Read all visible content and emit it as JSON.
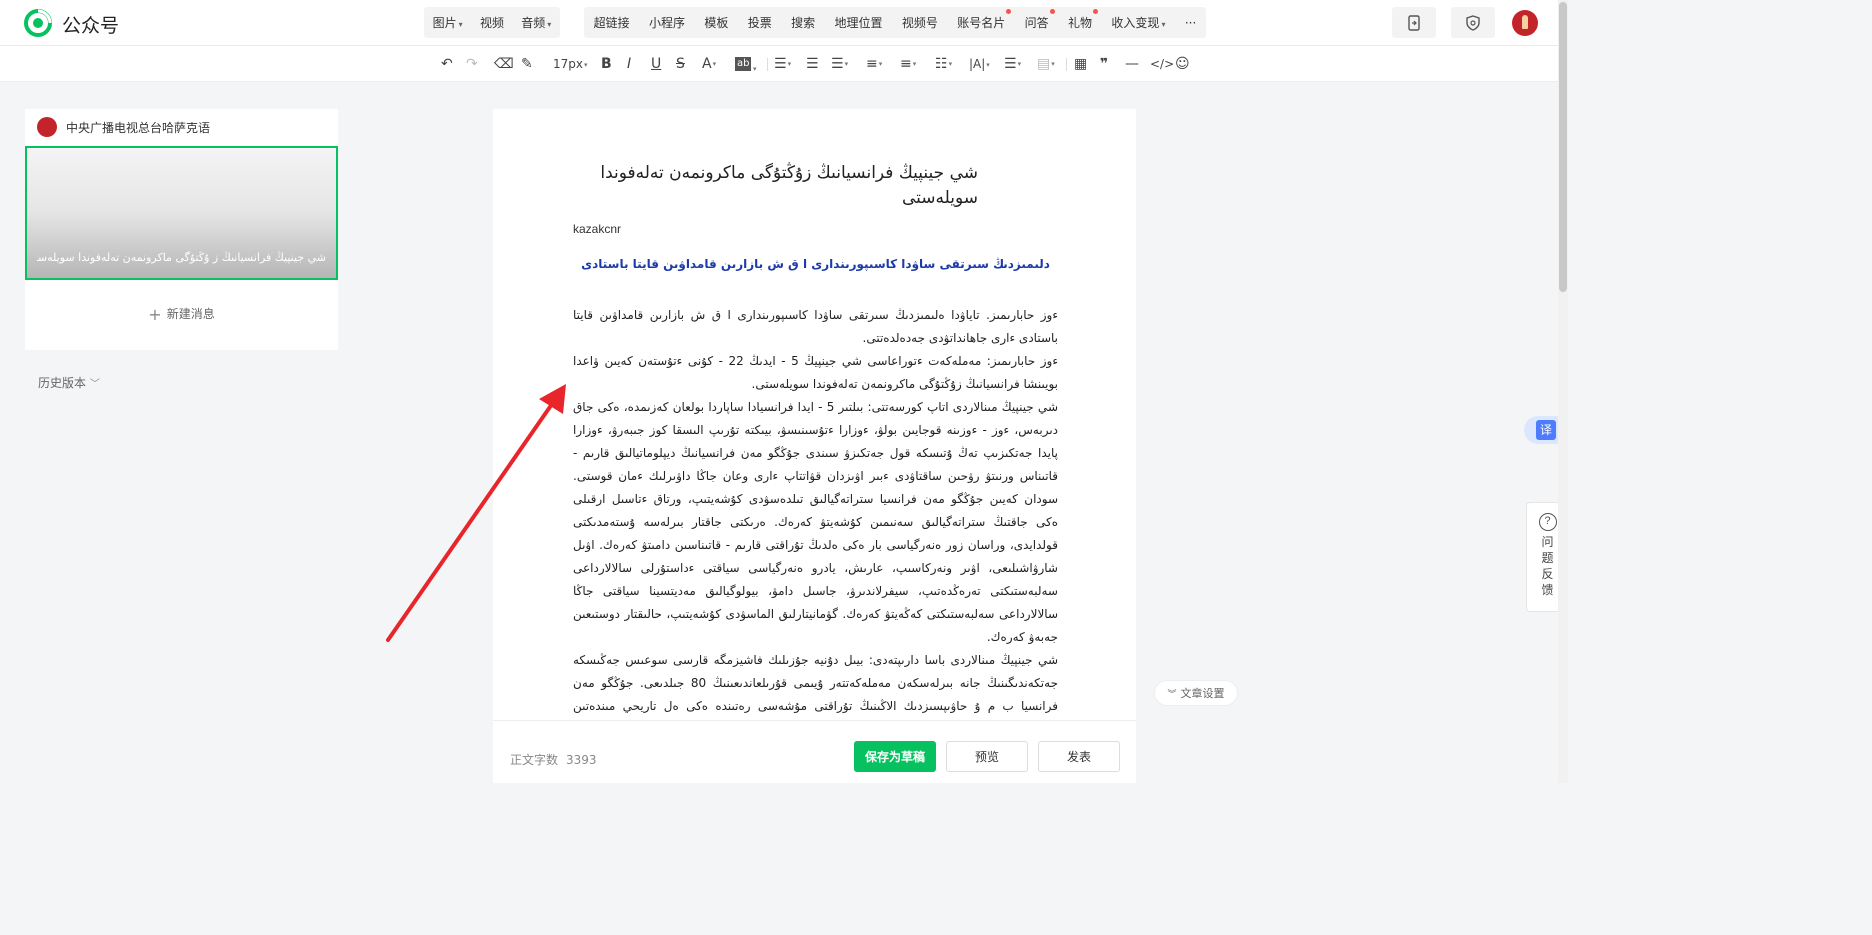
{
  "app": {
    "brand": "公众号"
  },
  "topnav": {
    "group1": [
      {
        "label": "图片",
        "dropdown": true
      },
      {
        "label": "视频",
        "dropdown": false
      },
      {
        "label": "音频",
        "dropdown": true
      }
    ],
    "group2": [
      {
        "label": "超链接",
        "dropdown": false,
        "dot": false
      },
      {
        "label": "小程序",
        "dropdown": false,
        "dot": false
      },
      {
        "label": "模板",
        "dropdown": false,
        "dot": false
      },
      {
        "label": "投票",
        "dropdown": false,
        "dot": false
      },
      {
        "label": "搜索",
        "dropdown": false,
        "dot": false
      },
      {
        "label": "地理位置",
        "dropdown": false,
        "dot": false
      },
      {
        "label": "视频号",
        "dropdown": false,
        "dot": false
      },
      {
        "label": "账号名片",
        "dropdown": false,
        "dot": true
      },
      {
        "label": "问答",
        "dropdown": false,
        "dot": true
      },
      {
        "label": "礼物",
        "dropdown": false,
        "dot": true
      },
      {
        "label": "收入变现",
        "dropdown": true,
        "dot": false
      },
      {
        "label": "···",
        "dropdown": false,
        "dot": false
      }
    ]
  },
  "toolbar": {
    "font_size": "17px"
  },
  "sidebar": {
    "account_name": "中央广播电视总台哈萨克语",
    "cover_title": "شي جينپيڭ فرانسيانىڭ ز ۇڭتۇگى ماكرونمەن تەلەفوندا سويلەستى",
    "new_message": "新建消息",
    "history": "历史版本"
  },
  "article": {
    "title": "شي جينپيڭ فرانسيانىڭ زۇڭتۇگى ماكرونمەن تەلەفوندا سويلەستى",
    "author": "kazakcnr",
    "subhead": "دلىمىزدىڭ سىرتقى ساۋدا كاسىپورىندارى ا ق ش بازارىن قامداۋىن قايتا باستادى",
    "paragraphs": [
      "ءوز حابارىمىز. تاياۋدا ەلىمىزدىڭ سىرتقى ساۋدا كاسىپورىندارى ا ق ش بازارىن قامداۋىن قايتا باستادى ءارى جاھانداتۋدى جەدەلدەتتى.",
      "ءوز حابارىمىز: مەملەكەت ءتوراعاسى شي جينپيڭ 5 - ايدىڭ 22 - كۇنى ءتۇستەن كەيىن ۋاعدا بويىنشا فرانسيانىڭ زۇڭتۇگى ماكرونمەن تەلەفوندا سويلەستى.",
      "شي جينپيڭ مىنالاردى اتاپ كورسەتتى: بىلتىر 5 - ايدا فرانسيادا ساپاردا بولعان كەزىمدە، ەكى جاق دىربەس، ءوز - ءوزىنە قوجايىن بولۋ، ءوزارا ءتۇسىنىسۋ، بيىكتە تۇرىپ الىسقا كوز جىبەرۋ، ءوزارا پايدا جەتكىزىپ تەڭ ۇتىسكە قول جەتكىزۋ سىندى جۇڭگو مەن فرانسيانىڭ ديپلوماتيالىق قارىم - قاتىناس ورنىتۋ رۋحىن ساقتاۋدى ءبىر اۋىزدان قۋاتتاپ ءارى وعان جاڭا داۋىرلىك ءمان قوستى. سودان كەيىن جۇڭگو مەن فرانسيا ستراتەگيالىق تىلدەسۋدى كۇشەيتىپ، ورتاق ءتاسىل ارقىلى ەكى جاقتىڭ ستراتەگيالىق سەنىمىن كۇشەيتۋ كەرەك. ەرىكتى جاقتار بىرلەسە ۇستەمدىكتى قولدايدى، وراسان زور ەنەرگياسى بار ەكى ەلدىڭ تۇراقتى قارىم - قاتىناسىن دامىتۋ كەرەك. اۋىل شارۋاشىلىعى، اۋىر ونەركاسىپ، عارىش، يادرو ەنەرگياسى سياقتى ءداستۇرلى سالالارداعى سەلبەستىكتى تەرەڭدەتىپ، سيفرلاندىرۋ، جاسىل دامۋ، بيولوگيالىق مەديتسينا سياقتى جاڭا سالالارداعى سەلبەستىكتى كەڭەيتۋ كەرەك. گۋمانيتارلىق الماسۋدى كۇشەيتىپ، حالىقتار دوستىعىن جەبەۋ كەرەك.",
      "شي جينپيڭ مىنالاردى باسا دارىپتەدى: بيىل دۇنيە جۇزىلىك فاشيزمگە قارسى سوعىس جەڭىسكە جەتكەندىگىنىڭ جانە بىرلەسكەن مەملەكەتتەر ۇيىمى قۇرىلعاندىعىنىڭ 80 جىلدىعى. جۇڭگو مەن فرانسيا ب م ۇ حاۋىپسىزدىك الاڭىنىڭ تۇراقتى مۇشەسى رەتىندە ەكى ەل تاريحي مىندەتىن اتقارىپ،"
    ]
  },
  "bottombar": {
    "wordcount_label": "正文字数",
    "wordcount_value": "3393",
    "save_draft": "保存为草稿",
    "preview": "预览",
    "publish": "发表"
  },
  "floating": {
    "article_settings": "文章设置",
    "translate": "译",
    "feedback": "问题反馈"
  },
  "colors": {
    "primary": "#07c160",
    "link_blue": "#1c3aa9",
    "annotation_arrow": "#e8252b",
    "notice_dot": "#fa5151"
  }
}
